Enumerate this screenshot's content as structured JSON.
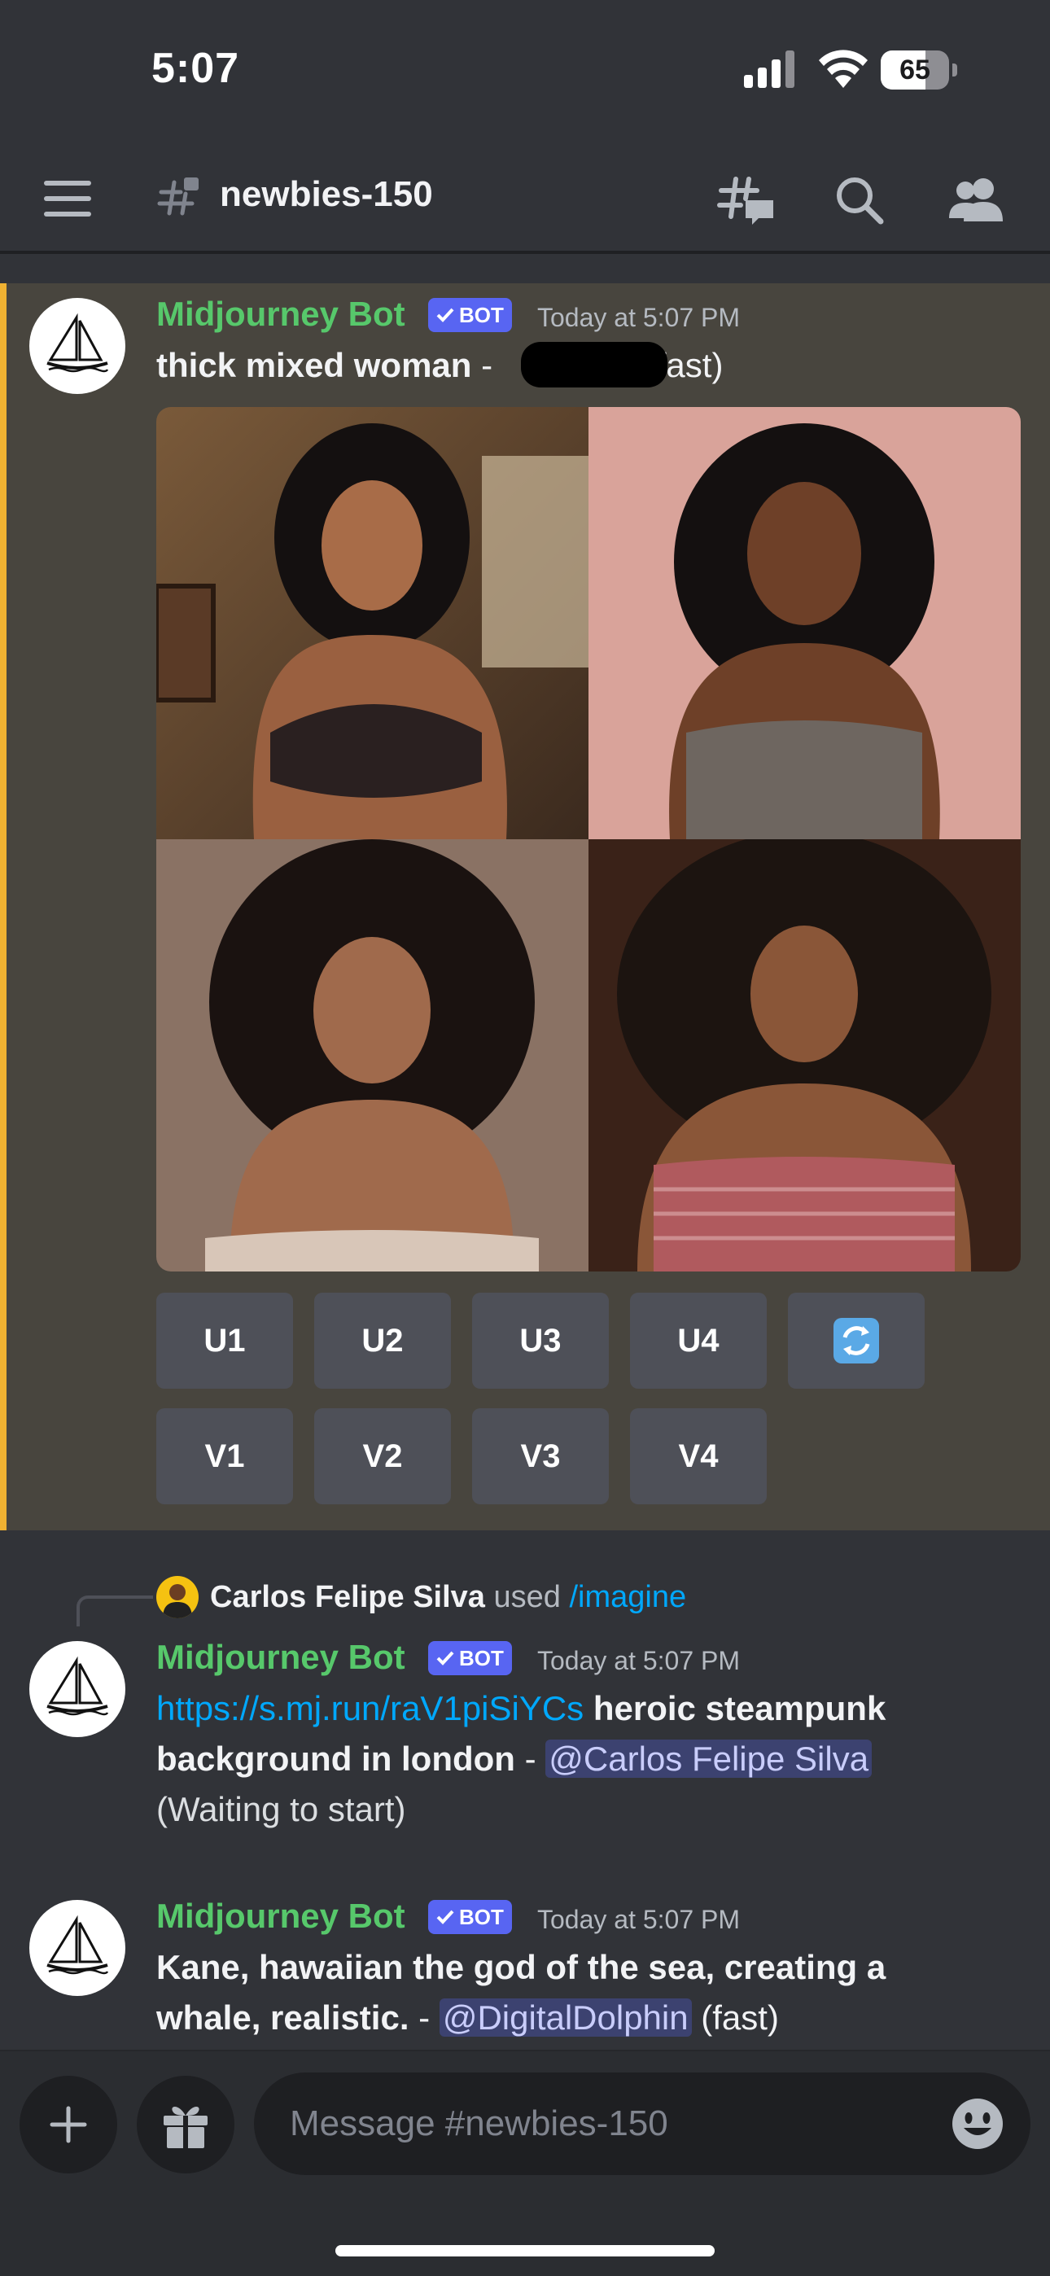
{
  "status_bar": {
    "time": "5:07",
    "battery_level": "65",
    "battery_fraction": 0.65
  },
  "header": {
    "channel_name": "newbies-150"
  },
  "messages": [
    {
      "username": "Midjourney Bot",
      "badge": "BOT",
      "timestamp": "Today at 5:07 PM",
      "prompt": "thick mixed woman",
      "separator": " - ",
      "status": "(fast)",
      "buttons_row1": [
        "U1",
        "U2",
        "U3",
        "U4"
      ],
      "buttons_row2": [
        "V1",
        "V2",
        "V3",
        "V4"
      ]
    },
    {
      "reply": {
        "user": "Carlos Felipe Silva",
        "verb": "used",
        "command": "/imagine"
      },
      "username": "Midjourney Bot",
      "badge": "BOT",
      "timestamp": "Today at 5:07 PM",
      "link": "https://s.mj.run/raV1piSiYCs",
      "prompt_line1": "heroic steampunk",
      "prompt_line2": "background in london",
      "separator": " - ",
      "mention": "@Carlos Felipe Silva",
      "status": "(Waiting to start)"
    },
    {
      "username": "Midjourney Bot",
      "badge": "BOT",
      "timestamp": "Today at 5:07 PM",
      "prompt_line1": "Kane, hawaiian the god of the sea, creating a",
      "prompt_line2": "whale, realistic.",
      "separator": " - ",
      "mention": "@DigitalDolphin",
      "status": "(fast)"
    }
  ],
  "composer": {
    "placeholder": "Message #newbies-150"
  },
  "colors": {
    "background": "#313338",
    "highlight": "#48453e",
    "highlight_bar": "#f0b232",
    "username": "#57c86b",
    "bot_badge": "#5865f2",
    "link": "#00a8fc",
    "button": "#4e5058"
  },
  "icons": [
    "menu-icon",
    "hash-icon",
    "threads-icon",
    "search-icon",
    "members-icon",
    "refresh-icon",
    "plus-icon",
    "gift-icon",
    "emoji-icon"
  ]
}
